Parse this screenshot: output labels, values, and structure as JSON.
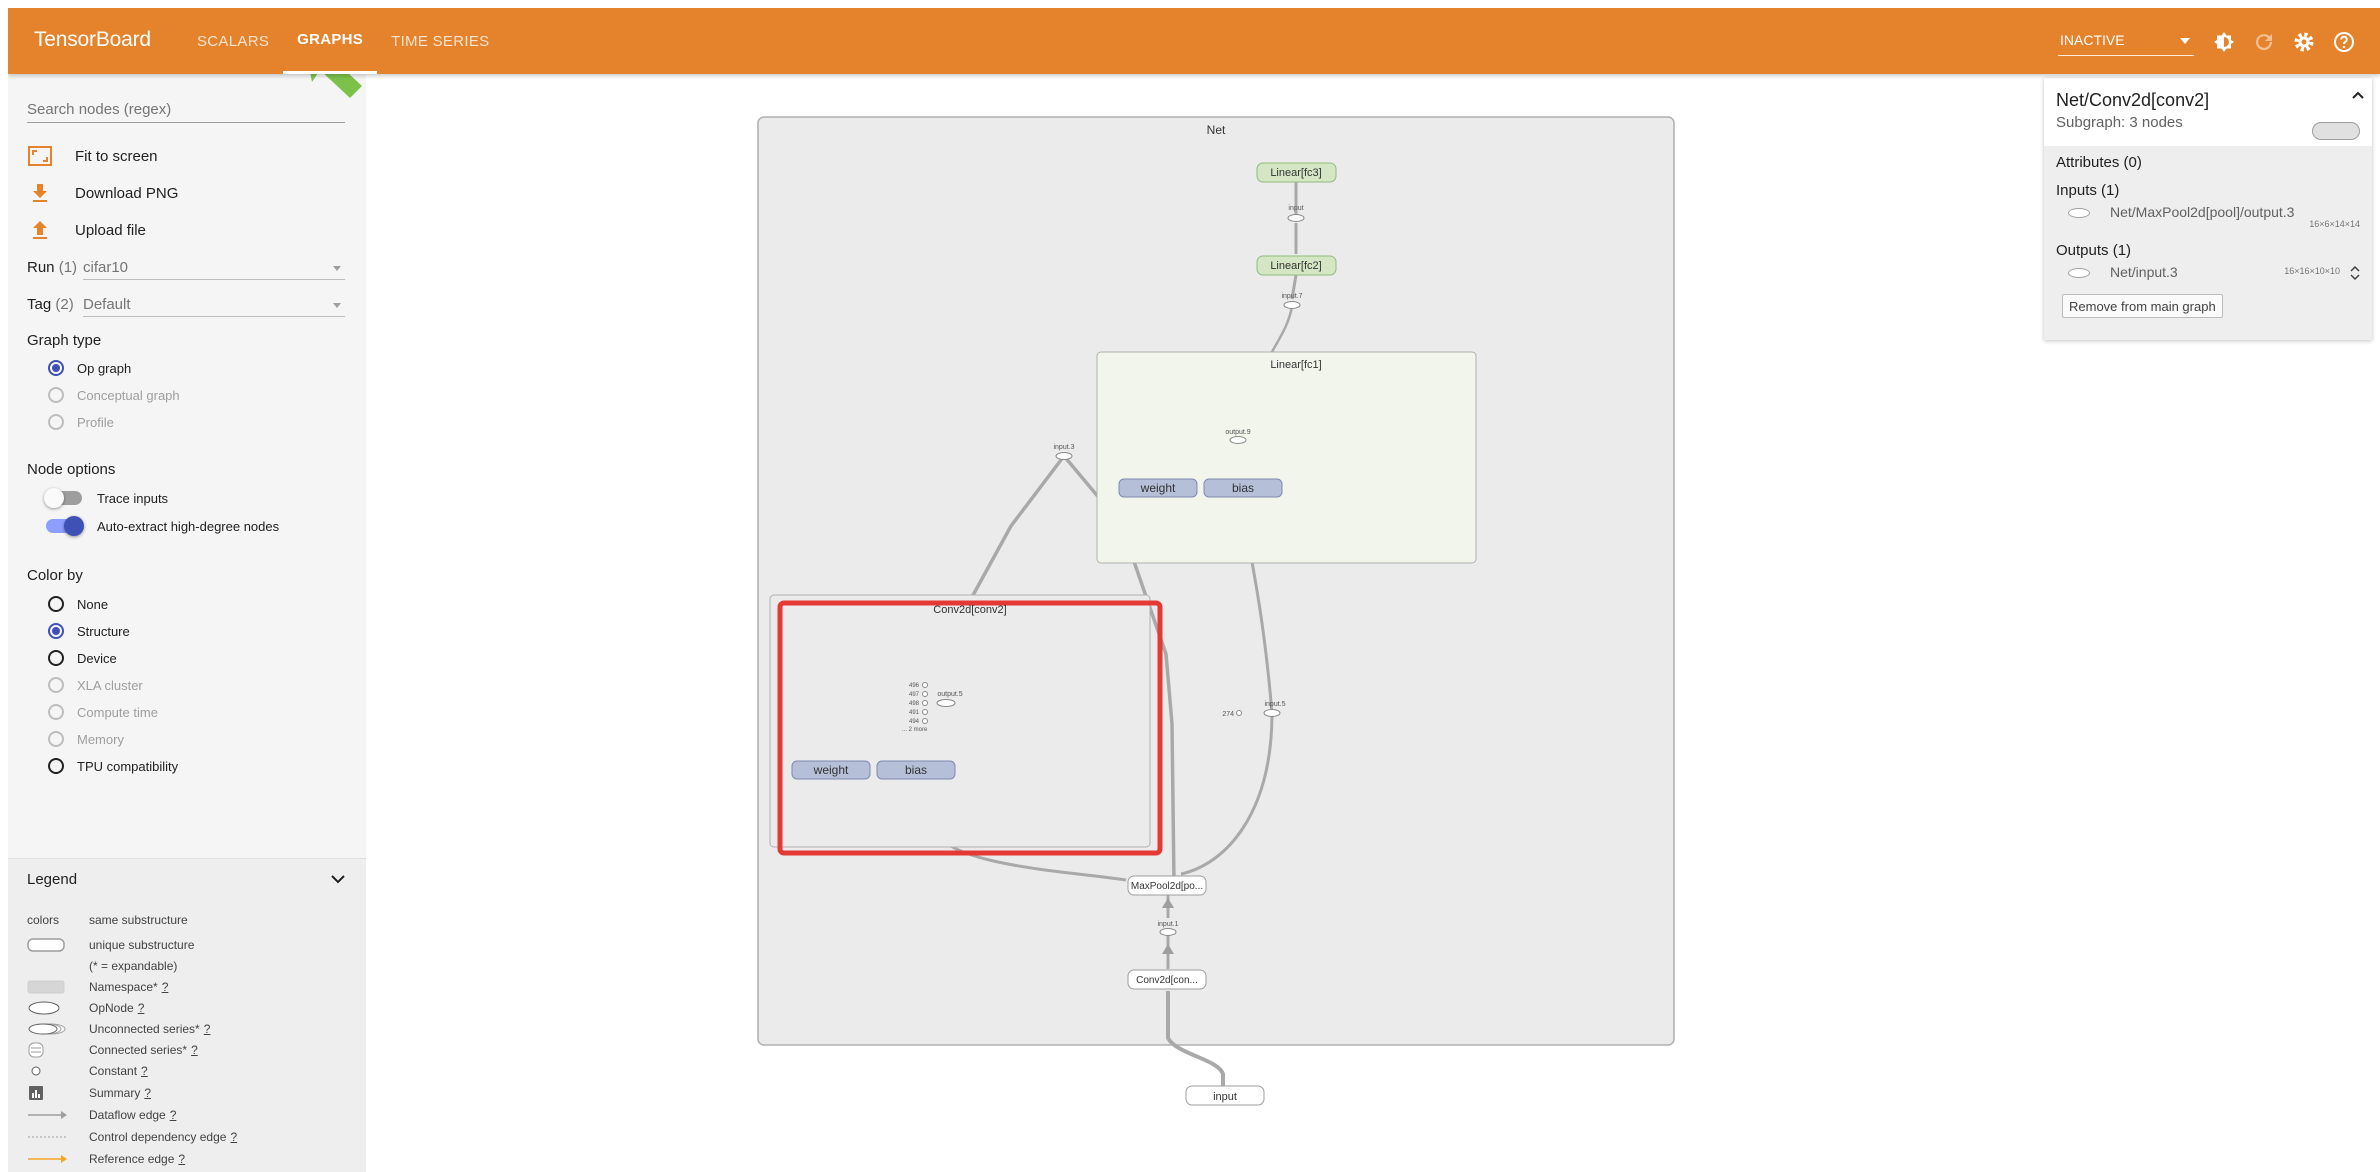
{
  "app": {
    "title": "TensorBoard"
  },
  "nav": {
    "tabs": [
      {
        "label": "SCALARS",
        "active": false
      },
      {
        "label": "GRAPHS",
        "active": true
      },
      {
        "label": "TIME SERIES",
        "active": false
      }
    ],
    "run_status": "INACTIVE",
    "icons": [
      "brightness-icon",
      "refresh-icon",
      "settings-icon",
      "help-icon"
    ]
  },
  "sidebar": {
    "search_placeholder": "Search nodes (regex)",
    "actions": [
      {
        "label": "Fit to screen",
        "icon": "fit-screen-icon"
      },
      {
        "label": "Download PNG",
        "icon": "download-icon"
      },
      {
        "label": "Upload file",
        "icon": "upload-icon"
      }
    ],
    "run": {
      "label": "Run",
      "count": "(1)",
      "value": "cifar10"
    },
    "tag": {
      "label": "Tag",
      "count": "(2)",
      "value": "Default"
    },
    "graph_type": {
      "title": "Graph type",
      "options": [
        {
          "label": "Op graph",
          "selected": true,
          "enabled": true
        },
        {
          "label": "Conceptual graph",
          "selected": false,
          "enabled": false
        },
        {
          "label": "Profile",
          "selected": false,
          "enabled": false
        }
      ]
    },
    "node_options": {
      "title": "Node options",
      "toggles": [
        {
          "label": "Trace inputs",
          "on": false
        },
        {
          "label": "Auto-extract high-degree nodes",
          "on": true
        }
      ]
    },
    "color_by": {
      "title": "Color by",
      "options": [
        {
          "label": "None",
          "selected": false,
          "enabled": true
        },
        {
          "label": "Structure",
          "selected": true,
          "enabled": true
        },
        {
          "label": "Device",
          "selected": false,
          "enabled": true
        },
        {
          "label": "XLA cluster",
          "selected": false,
          "enabled": false
        },
        {
          "label": "Compute time",
          "selected": false,
          "enabled": false
        },
        {
          "label": "Memory",
          "selected": false,
          "enabled": false
        },
        {
          "label": "TPU compatibility",
          "selected": false,
          "enabled": true
        }
      ]
    },
    "legend": {
      "title": "Legend",
      "colors_label": "colors",
      "same_substructure": "same substructure",
      "unique_substructure": "unique substructure",
      "expandable_note": "(* = expandable)",
      "items": [
        {
          "label": "Namespace*",
          "q": "?"
        },
        {
          "label": "OpNode",
          "q": "?"
        },
        {
          "label": "Unconnected series*",
          "q": "?"
        },
        {
          "label": "Connected series*",
          "q": "?"
        },
        {
          "label": "Constant",
          "q": "?"
        },
        {
          "label": "Summary",
          "q": "?"
        },
        {
          "label": "Dataflow edge",
          "q": "?"
        },
        {
          "label": "Control dependency edge",
          "q": "?"
        },
        {
          "label": "Reference edge",
          "q": "?"
        }
      ]
    }
  },
  "graph": {
    "root": "Net",
    "nodes": {
      "fc3": "Linear[fc3]",
      "fc2": "Linear[fc2]",
      "fc1": "Linear[fc1]",
      "conv2": "Conv2d[conv2]",
      "weight": "weight",
      "bias": "bias",
      "maxpool": "MaxPool2d[po...",
      "conv1": "Conv2d[con...",
      "input": "input"
    },
    "op_labels": {
      "input_top": "input",
      "input_7": "input.7",
      "output_9": "output.9",
      "input_3": "input.3",
      "output_5": "output.5",
      "input_5": "input.5",
      "input_1": "input.1",
      "const_274": "274",
      "c496": "496",
      "c497": "497",
      "c498": "498",
      "c491": "491",
      "c494": "494",
      "more": "... 2 more"
    }
  },
  "info_card": {
    "title": "Net/Conv2d[conv2]",
    "subtitle": "Subgraph: 3 nodes",
    "attributes": "Attributes (0)",
    "inputs_title": "Inputs (1)",
    "input_name": "Net/MaxPool2d[pool]/output.3",
    "input_shape": "16×6×14×14",
    "outputs_title": "Outputs (1)",
    "output_name": "Net/input.3",
    "output_shape": "16×16×10×10",
    "remove_button": "Remove from main graph"
  },
  "colors": {
    "header": "#e4832b",
    "accent": "#3f51b5",
    "highlight_box": "#e53935",
    "pointer": "#7cc24a",
    "linear_node": "#d4e6c4",
    "param_node": "#b6bfd8"
  }
}
